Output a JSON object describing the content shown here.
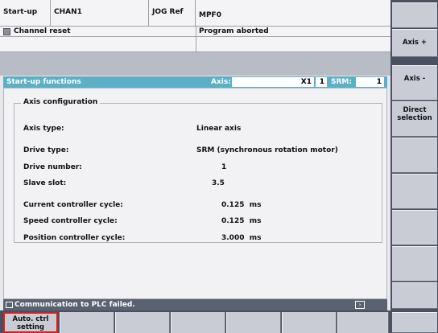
{
  "header": {
    "area": "Start-up",
    "channel": "CHAN1",
    "mode": "JOG Ref",
    "program": "MPF0",
    "channel_status": "Channel reset",
    "program_status": "Program aborted"
  },
  "titlebar": {
    "title": "Start-up functions",
    "axis_label": "Axis:",
    "axis_name": "X1",
    "axis_number": "1",
    "srm_label": "SRM:",
    "srm_number": "1"
  },
  "axis_config": {
    "group_title": "Axis configuration",
    "rows": [
      {
        "label": "Axis type:",
        "value": "Linear axis"
      },
      {
        "label": "Drive type:",
        "value": "SRM (synchronous rotation motor)"
      },
      {
        "label": "Drive number:",
        "value": "1"
      },
      {
        "label": "Slave slot:",
        "value": "3.5"
      },
      {
        "label": "Current controller cycle:",
        "value": "0.125  ms"
      },
      {
        "label": "Speed controller cycle:",
        "value": "0.125  ms"
      },
      {
        "label": "Position controller cycle:",
        "value": "3.000  ms"
      }
    ]
  },
  "status_bar": {
    "message": "Communication to PLC failed."
  },
  "vertical_softkeys": [
    {
      "label": "Axis +"
    },
    {
      "label": "Axis -"
    },
    {
      "label_line1": "Direct",
      "label_line2": "selection"
    }
  ],
  "horizontal_softkeys": [
    {
      "label_line1": "Auto. ctrl",
      "label_line2": "setting"
    }
  ]
}
